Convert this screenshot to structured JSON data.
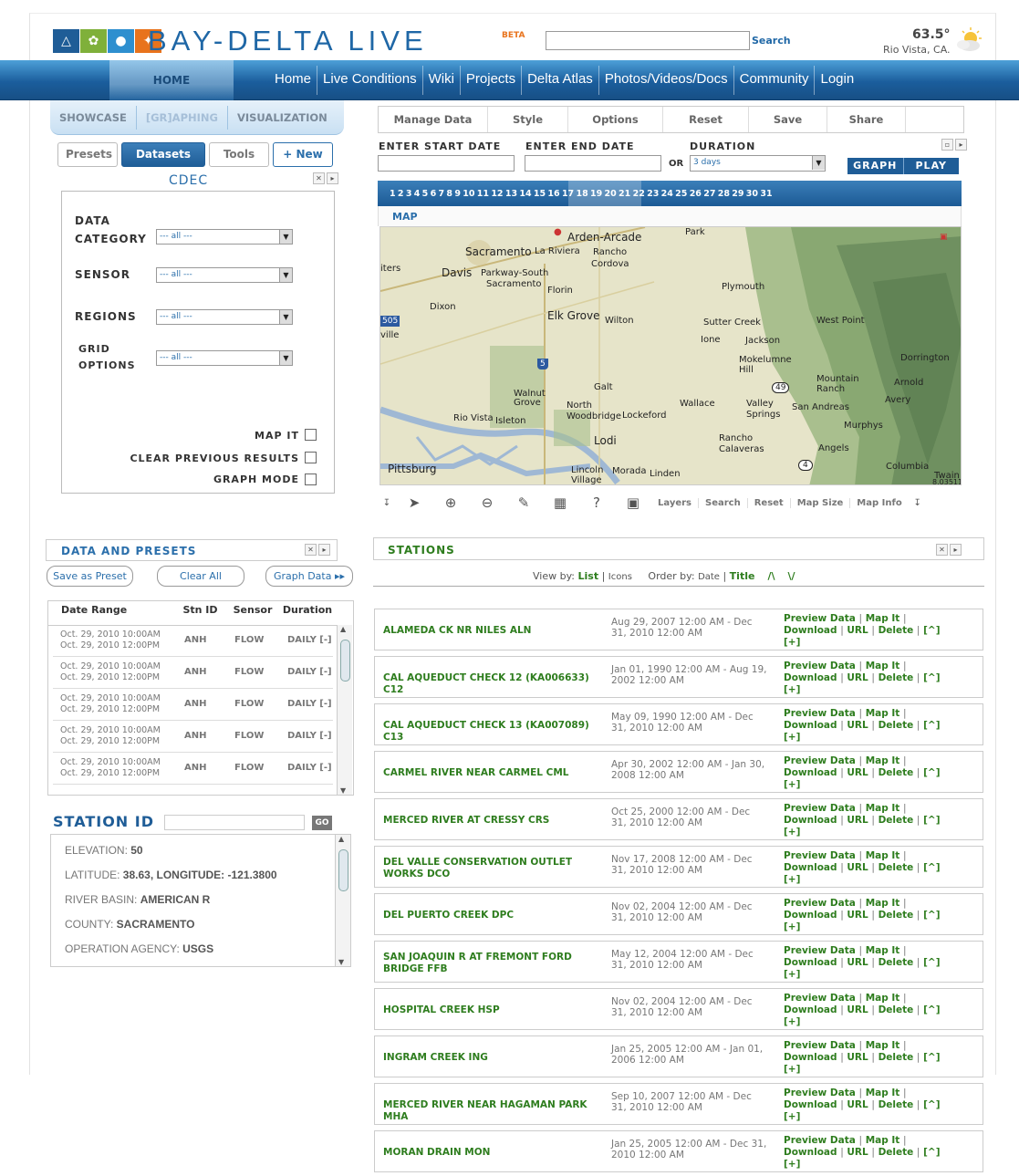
{
  "brand": {
    "title": "BAY-DELTA LIVE",
    "beta": "BETA",
    "search_label": "Search"
  },
  "weather": {
    "temp": "63.5°",
    "location": "Rio Vista, CA."
  },
  "nav": {
    "active": "HOME",
    "items": [
      "Home",
      "Live Conditions",
      "Wiki",
      "Projects",
      "Delta Atlas",
      "Photos/Videos/Docs",
      "Community",
      "Login"
    ]
  },
  "subtabs": [
    "SHOWCASE",
    "[GR]APHING",
    "VISUALIZATION"
  ],
  "pilltabs": {
    "presets": "Presets",
    "datasets": "Datasets",
    "tools": "Tools",
    "new": "+ New"
  },
  "dataset": {
    "source": "CDEC"
  },
  "filters": {
    "data_category": "DATA\nCATEGORY",
    "sensor": "SENSOR",
    "regions": "REGIONS",
    "grid_options": "GRID\nOPTIONS",
    "select_value": "--- all ---",
    "map_it": "MAP IT",
    "clear_previous": "CLEAR PREVIOUS RESULTS",
    "graph_mode": "GRAPH MODE"
  },
  "toolbar": [
    "Manage Data",
    "Style",
    "Options",
    "Reset",
    "Save",
    "Share"
  ],
  "dates": {
    "start_label": "ENTER START DATE",
    "end_label": "ENTER END DATE",
    "or": "OR",
    "duration_label": "DURATION",
    "duration_value": "3 days",
    "graph": "GRAPH",
    "play": "PLAY"
  },
  "numbers": "1 2 3 4 5 6 7 8 9 10 11 12 13 14 15 16 17 18 19 20 21 22 23 24 25 26 27 28 29 30 31",
  "map": {
    "title": "MAP",
    "scale": "8.03511",
    "places": [
      "Arden-Arcade",
      "Park",
      "Sacramento",
      "La Riviera",
      "Rancho",
      "Cordova",
      "Davis",
      "Parkway-South",
      "Sacramento",
      "Florin",
      "Plymouth",
      "Dixon",
      "Elk Grove",
      "Wilton",
      "Sutter Creek",
      "West Point",
      "Ione",
      "Jackson",
      "Mokelumne Hill",
      "Galt",
      "Walnut Grove",
      "North Woodbridge",
      "Lockeford",
      "Wallace",
      "Valley Springs",
      "San Andreas",
      "Mountain Ranch",
      "Rio Vista",
      "Isleton",
      "Lodi",
      "Rancho Calaveras",
      "Murphys",
      "Pittsburg",
      "Lincoln Village",
      "Morada",
      "Linden",
      "Angels",
      "Columbia",
      "Twain",
      "Avery",
      "Arnold",
      "Dorrington",
      "iters",
      "ville"
    ],
    "shields": {
      "i505": "505",
      "i5": "5",
      "r49": "49",
      "r4": "4"
    },
    "tools": [
      "Layers",
      "Search",
      "Reset",
      "Map Size",
      "Map Info"
    ]
  },
  "presets_panel": {
    "title": "DATA AND PRESETS",
    "save": "Save as Preset",
    "clear": "Clear All",
    "graph": "Graph Data ▸▸",
    "headers": [
      "Date Range",
      "Stn ID",
      "Sensor",
      "Duration"
    ],
    "rows": [
      {
        "d1": "Oct. 29, 2010  10:00AM",
        "d2": "Oct. 29, 2010  12:00PM",
        "stn": "ANH",
        "sensor": "FLOW",
        "dur": "DAILY [-]"
      },
      {
        "d1": "Oct. 29, 2010  10:00AM",
        "d2": "Oct. 29, 2010  12:00PM",
        "stn": "ANH",
        "sensor": "FLOW",
        "dur": "DAILY [-]"
      },
      {
        "d1": "Oct. 29, 2010  10:00AM",
        "d2": "Oct. 29, 2010  12:00PM",
        "stn": "ANH",
        "sensor": "FLOW",
        "dur": "DAILY [-]"
      },
      {
        "d1": "Oct. 29, 2010  10:00AM",
        "d2": "Oct. 29, 2010  12:00PM",
        "stn": "ANH",
        "sensor": "FLOW",
        "dur": "DAILY [-]"
      },
      {
        "d1": "Oct. 29, 2010  10:00AM",
        "d2": "Oct. 29, 2010  12:00PM",
        "stn": "ANH",
        "sensor": "FLOW",
        "dur": "DAILY [-]"
      }
    ]
  },
  "station_id": {
    "label": "STATION ID",
    "go": "GO",
    "info": [
      {
        "k": "ELEVATION: ",
        "v": "50"
      },
      {
        "k": "LATITUDE: ",
        "v": "38.63,  LONGITUDE: -121.3800"
      },
      {
        "k": "RIVER BASIN: ",
        "v": "AMERICAN R"
      },
      {
        "k": "COUNTY: ",
        "v": "SACRAMENTO"
      },
      {
        "k": "OPERATION AGENCY: ",
        "v": "USGS"
      }
    ]
  },
  "stations": {
    "title": "STATIONS",
    "view_by": "View by:",
    "list": "List",
    "icons": "Icons",
    "order_by": "Order by:",
    "date": "Date",
    "title_sort": "Title",
    "asc": "/\\",
    "desc": "\\/",
    "actions": {
      "preview": "Preview Data",
      "map": "Map It",
      "download": "Download",
      "url": "URL",
      "delete": "Delete",
      "up": "[^]",
      "plus": "[+]"
    },
    "rows": [
      {
        "name": "ALAMEDA CK NR NILES ALN",
        "range": "Aug 29, 2007 12:00 AM - Dec 31, 2010 12:00 AM"
      },
      {
        "name": "CAL AQUEDUCT CHECK 12 (KA006633) C12",
        "range": "Jan 01, 1990 12:00 AM - Aug 19, 2002 12:00 AM"
      },
      {
        "name": "CAL AQUEDUCT CHECK 13 (KA007089) C13",
        "range": "May 09, 1990 12:00 AM - Dec 31, 2010 12:00 AM"
      },
      {
        "name": "CARMEL RIVER NEAR CARMEL CML",
        "range": "Apr 30, 2002 12:00 AM - Jan 30, 2008 12:00 AM"
      },
      {
        "name": "MERCED RIVER AT CRESSY CRS",
        "range": "Oct 25, 2000 12:00 AM - Dec 31, 2010 12:00 AM"
      },
      {
        "name": "DEL VALLE CONSERVATION OUTLET WORKS DCO",
        "range": "Nov 17, 2008 12:00 AM - Dec 31, 2010 12:00 AM"
      },
      {
        "name": "DEL PUERTO CREEK DPC",
        "range": "Nov 02, 2004 12:00 AM - Dec 31, 2010 12:00 AM"
      },
      {
        "name": "SAN JOAQUIN R AT FREMONT FORD BRIDGE FFB",
        "range": "May 12, 2004 12:00 AM - Dec 31, 2010 12:00 AM"
      },
      {
        "name": "HOSPITAL CREEK HSP",
        "range": "Nov 02, 2004 12:00 AM - Dec 31, 2010 12:00 AM"
      },
      {
        "name": "INGRAM CREEK ING",
        "range": "Jan 25, 2005 12:00 AM - Jan 01, 2006 12:00 AM"
      },
      {
        "name": "MERCED RIVER NEAR HAGAMAN PARK MHA",
        "range": "Sep 10, 2007 12:00 AM - Dec 31, 2010 12:00 AM"
      },
      {
        "name": "MORAN DRAIN MON",
        "range": "Jan 25, 2005 12:00 AM - Dec 31, 2010 12:00 AM"
      }
    ]
  },
  "colors": {
    "brand_blue": "#1f67a6",
    "nav_blue": "#1b5e9d",
    "station_green": "#2e7d1e",
    "beta_orange": "#e8731c"
  }
}
